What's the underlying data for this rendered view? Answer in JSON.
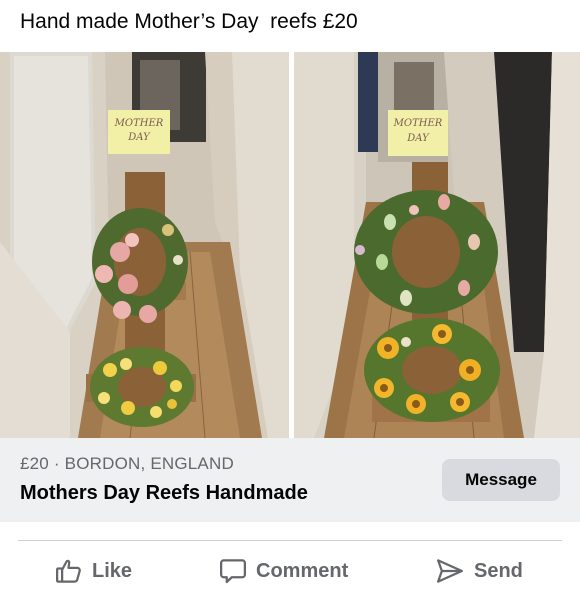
{
  "post": {
    "text": "Hand made Mother’s Day  reefs £20"
  },
  "photos": {
    "left_sign": [
      "MOTHER",
      "DAY"
    ],
    "right_sign": [
      "MOTHER",
      "DAY"
    ]
  },
  "listing": {
    "price_location": "£20 · BORDON, ENGLAND",
    "title": "Mothers Day Reefs Handmade",
    "message_label": "Message"
  },
  "actions": {
    "like": "Like",
    "comment": "Comment",
    "send": "Send"
  },
  "colors": {
    "text_primary": "#050505",
    "text_secondary": "#65676b",
    "listing_bg": "#eef0f2",
    "button_bg": "#d8dadf"
  },
  "icons": {
    "like": "thumbs-up-icon",
    "comment": "speech-bubble-icon",
    "send": "paper-plane-icon"
  }
}
